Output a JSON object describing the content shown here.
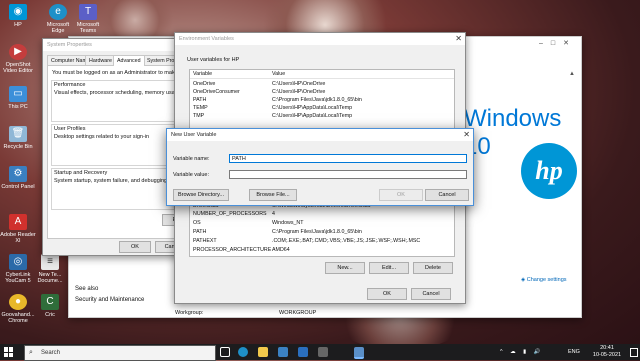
{
  "desktop": {
    "icons": [
      {
        "label": "HP"
      },
      {
        "label": "Microsoft Edge"
      },
      {
        "label": "Microsoft Teams"
      },
      {
        "label": "OpenShot Video Editor"
      },
      {
        "label": "This PC"
      },
      {
        "label": "Recycle Bin"
      },
      {
        "label": "Control Panel"
      },
      {
        "label": "Adobe Reader XI"
      },
      {
        "label": "CyberLink YouCam 5"
      },
      {
        "label": "New Te... Docume..."
      },
      {
        "label": "Goovahand... Chrome"
      },
      {
        "label": "Cric"
      }
    ]
  },
  "settings_bg": {
    "windows_logo_text": "Windows 10",
    "brand_logo_text": "hp",
    "see_also": "See also",
    "security_link": "Security and Maintenance",
    "change_settings": "Change settings",
    "workgroup_left": "Workgroup:",
    "workgroup_right": "WORKGROUP"
  },
  "system_properties": {
    "title": "System Properties",
    "tabs": [
      "Computer Name",
      "Hardware",
      "Advanced",
      "System Protect"
    ],
    "admin_note": "You must be logged on as an Administrator to make mos",
    "performance_title": "Performance",
    "performance_text": "Visual effects, processor scheduling, memory usage, an",
    "user_profiles_title": "User Profiles",
    "user_profiles_text": "Desktop settings related to your sign-in",
    "startup_title": "Startup and Recovery",
    "startup_text": "System startup, system failure, and debugging inform",
    "env_button": "Envi",
    "ok": "OK",
    "cancel": "Canc"
  },
  "env_vars": {
    "title": "Environment Variables",
    "user_section": "User variables for HP",
    "columns": {
      "variable": "Variable",
      "value": "Value"
    },
    "user_rows": [
      {
        "var": "OneDrive",
        "val": "C:\\Users\\HP\\OneDrive"
      },
      {
        "var": "OneDriveConsumer",
        "val": "C:\\Users\\HP\\OneDrive"
      },
      {
        "var": "PATH",
        "val": "C:\\Program Files\\Java\\jdk1.8.0_65\\bin"
      },
      {
        "var": "TEMP",
        "val": "C:\\Users\\HP\\AppData\\Local\\Temp"
      },
      {
        "var": "TMP",
        "val": "C:\\Users\\HP\\AppData\\Local\\Temp"
      }
    ],
    "system_rows": [
      {
        "var": "DriverData",
        "val": "C:\\Windows\\System32\\Drivers\\DriverData"
      },
      {
        "var": "NUMBER_OF_PROCESSORS",
        "val": "4"
      },
      {
        "var": "OS",
        "val": "Windows_NT"
      },
      {
        "var": "PATH",
        "val": "C:\\Program Files\\Java\\jdk1.8.0_65\\bin"
      },
      {
        "var": "PATHEXT",
        "val": ".COM;.EXE;.BAT;.CMD;.VBS;.VBE;.JS;.JSE;.WSF;.WSH;.MSC"
      },
      {
        "var": "PROCESSOR_ARCHITECTURE",
        "val": "AMD64"
      }
    ],
    "new_btn": "New...",
    "edit_btn": "Edit...",
    "delete_btn": "Delete",
    "ok": "OK",
    "cancel": "Cancel"
  },
  "new_user_variable": {
    "title": "New User Variable",
    "name_label": "Variable name:",
    "name_value": "PATH",
    "value_label": "Variable value:",
    "value_value": "",
    "browse_dir": "Browse Directory...",
    "browse_file": "Browse File...",
    "ok": "OK",
    "cancel": "Cancel"
  },
  "taskbar": {
    "search_placeholder": "Search",
    "lang": "ENG",
    "time": "20:41",
    "date": "10-05-2021"
  }
}
